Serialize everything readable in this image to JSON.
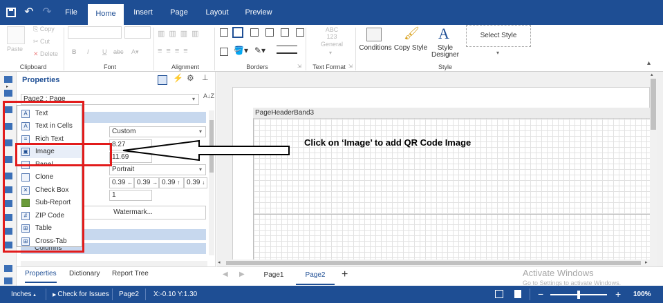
{
  "tabs": [
    "File",
    "Home",
    "Insert",
    "Page",
    "Layout",
    "Preview"
  ],
  "ribbon": {
    "clipboard": {
      "paste": "Paste",
      "copy": "Copy",
      "cut": "Cut",
      "delete": "Delete",
      "label": "Clipboard"
    },
    "font": {
      "label": "Font"
    },
    "alignment": {
      "label": "Alignment"
    },
    "borders": {
      "label": "Borders"
    },
    "text_format": {
      "abc": "ABC",
      "num": "123",
      "general": "General",
      "label": "Text Format"
    },
    "style": {
      "conditions": "Conditions",
      "copy_style": "Copy Style",
      "style_designer_1": "Style",
      "style_designer_2": "Designer",
      "select_style": "Select Style",
      "label": "Style"
    }
  },
  "properties": {
    "title": "Properties",
    "page_selector": "Page2 : Page",
    "custom": "Custom",
    "width": "8.27",
    "height": "11.69",
    "orientation": "Portrait",
    "margins": [
      "0.39",
      "0.39",
      "0.39",
      "0.39"
    ],
    "columns_value": "1",
    "watermark_btn": "Watermark...",
    "columns_band": "Columns"
  },
  "menu": [
    "Text",
    "Text in Cells",
    "Rich Text",
    "Image",
    "Panel",
    "Clone",
    "Check Box",
    "Sub-Report",
    "ZIP Code",
    "Table",
    "Cross-Tab"
  ],
  "bottom_tabs": [
    "Properties",
    "Dictionary",
    "Report Tree"
  ],
  "canvas": {
    "band_label": "PageHeaderBand3",
    "callout": "Click on ‘Image’ to add QR Code Image"
  },
  "page_tabs": [
    "Page1",
    "Page2"
  ],
  "status": {
    "units": "Inches",
    "check": "Check for Issues",
    "page": "Page2",
    "coords": "X:-0.10 Y:1.30",
    "zoom": "100%",
    "zoom_level": 0.5
  },
  "watermark": {
    "line1": "Activate Windows",
    "line2": "Go to Settings to activate Windows."
  },
  "colors": {
    "primary": "#1e4e94",
    "highlight": "#e21b1b"
  }
}
